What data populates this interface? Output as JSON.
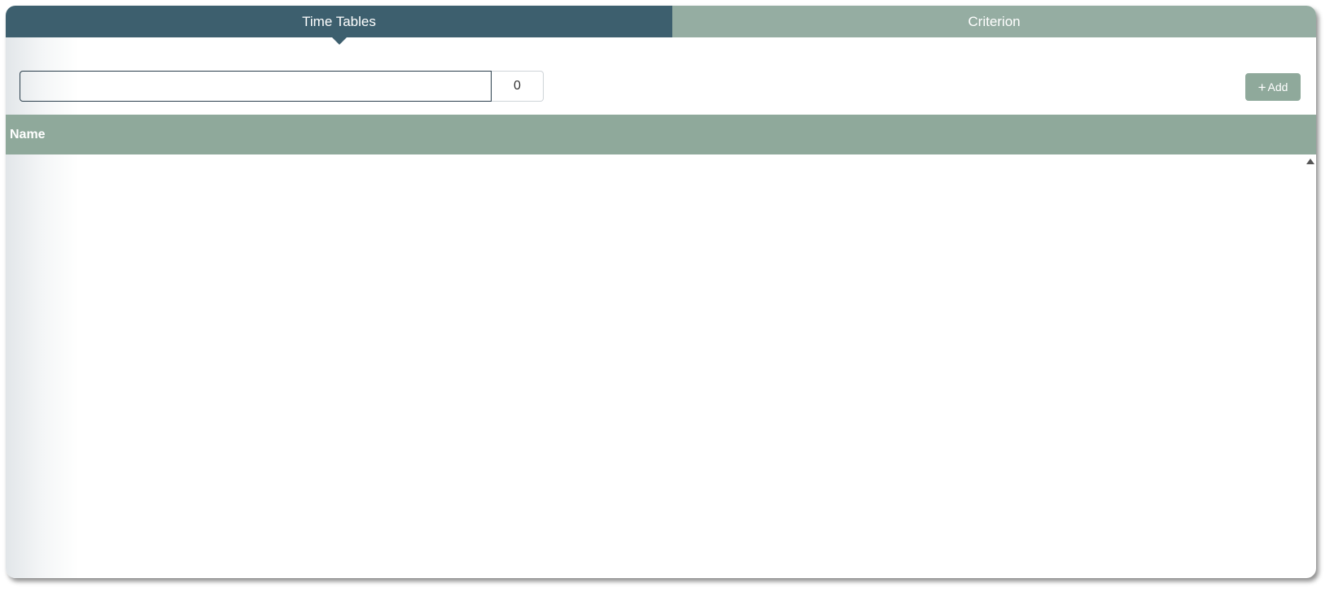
{
  "tabs": [
    {
      "label": "Time Tables",
      "active": true
    },
    {
      "label": "Criterion",
      "active": false
    }
  ],
  "toolbar": {
    "search_value": "",
    "count": "0",
    "add_label": "Add",
    "add_icon": "+"
  },
  "table": {
    "columns": [
      "Name"
    ],
    "rows": []
  },
  "colors": {
    "tab_active": "#3d5f6e",
    "tab_inactive": "#95ada2",
    "header": "#8fa99b",
    "button": "#8fa99b"
  }
}
